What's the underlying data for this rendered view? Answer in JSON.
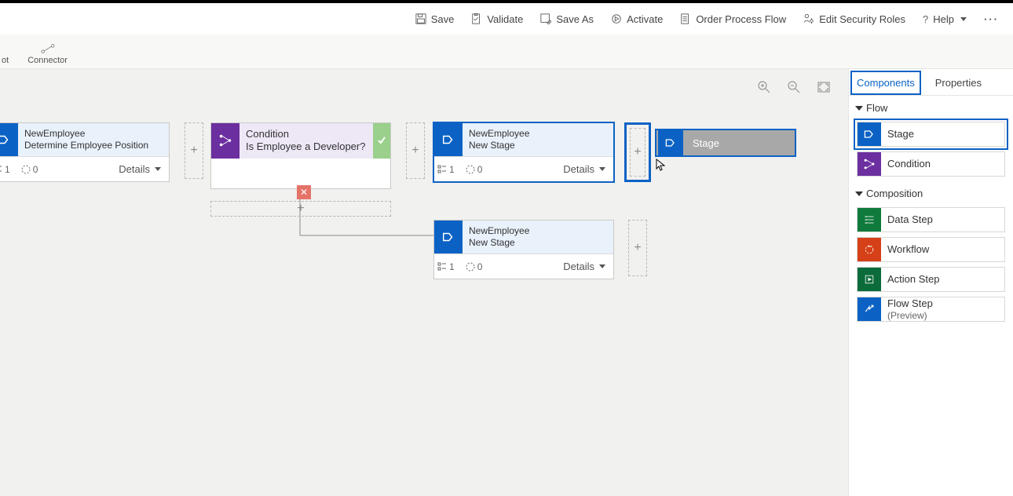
{
  "toolbar": {
    "save": "Save",
    "validate": "Validate",
    "save_as": "Save As",
    "activate": "Activate",
    "order": "Order Process Flow",
    "security": "Edit Security Roles",
    "help": "Help"
  },
  "subbar": {
    "snap_partial": "ot",
    "connector": "Connector"
  },
  "panel": {
    "tabs": {
      "components": "Components",
      "properties": "Properties"
    },
    "flow_header": "Flow",
    "composition_header": "Composition",
    "items": {
      "stage": "Stage",
      "condition": "Condition",
      "data_step": "Data Step",
      "workflow": "Workflow",
      "action_step": "Action Step",
      "flow_step": "Flow Step",
      "flow_step_sub": "(Preview)"
    }
  },
  "nodes": {
    "n1": {
      "entity": "NewEmployee",
      "title": "Determine Employee Position",
      "count1": "1",
      "count2": "0",
      "details": "Details"
    },
    "cond": {
      "heading": "Condition",
      "title": "Is Employee a Developer?"
    },
    "n2": {
      "entity": "NewEmployee",
      "title": "New Stage",
      "count1": "1",
      "count2": "0",
      "details": "Details"
    },
    "n3": {
      "entity": "NewEmployee",
      "title": "New Stage",
      "count1": "1",
      "count2": "0",
      "details": "Details"
    },
    "drag_label": "Stage"
  }
}
